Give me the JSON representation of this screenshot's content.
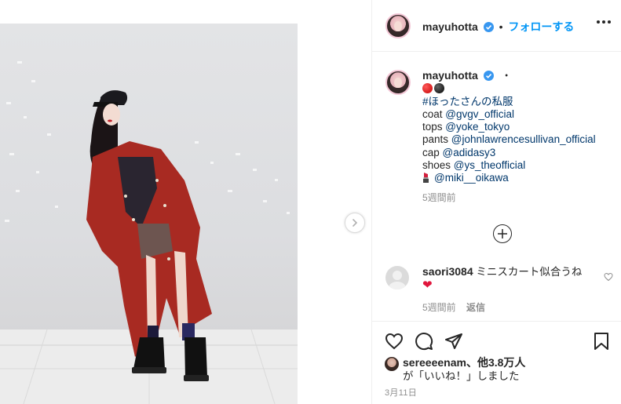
{
  "post": {
    "author": "mayuhotta",
    "follow_label": "フォローする",
    "header_separator": "•",
    "caption_separator": "・",
    "caption": {
      "hashtag": "#ほったさんの私服",
      "credits": [
        {
          "item": "coat",
          "handle": "@gvgv_official"
        },
        {
          "item": "tops",
          "handle": "@yoke_tokyo"
        },
        {
          "item": "pants",
          "handle": "@johnlawrencesullivan_official"
        },
        {
          "item": "cap",
          "handle": "@adidasy3"
        },
        {
          "item": "shoes",
          "handle": "@ys_theofficial"
        }
      ],
      "makeup_handle": "@miki__oikawa",
      "time_ago": "5週間前"
    },
    "comment": {
      "user": "saori3084",
      "text": "ミニスカート似合うね",
      "time_ago": "5週間前",
      "reply_label": "返信"
    },
    "likes": {
      "user": "sereeeenam",
      "text_suffix": "、他3.8万人",
      "text_line2": "が「いいね！」しました"
    },
    "date": "3月11日"
  },
  "icons": {
    "verified": "verified-badge-icon",
    "more": "more-options-icon",
    "next": "chevron-right-icon",
    "load_more": "plus-circle-icon",
    "like": "heart-icon",
    "comment": "comment-icon",
    "share": "paper-plane-icon",
    "save": "bookmark-icon"
  },
  "colors": {
    "link": "#00376b",
    "follow": "#0095f6",
    "verified": "#3897f0",
    "muted": "#8e8e8e",
    "coat": "#b3261e"
  }
}
